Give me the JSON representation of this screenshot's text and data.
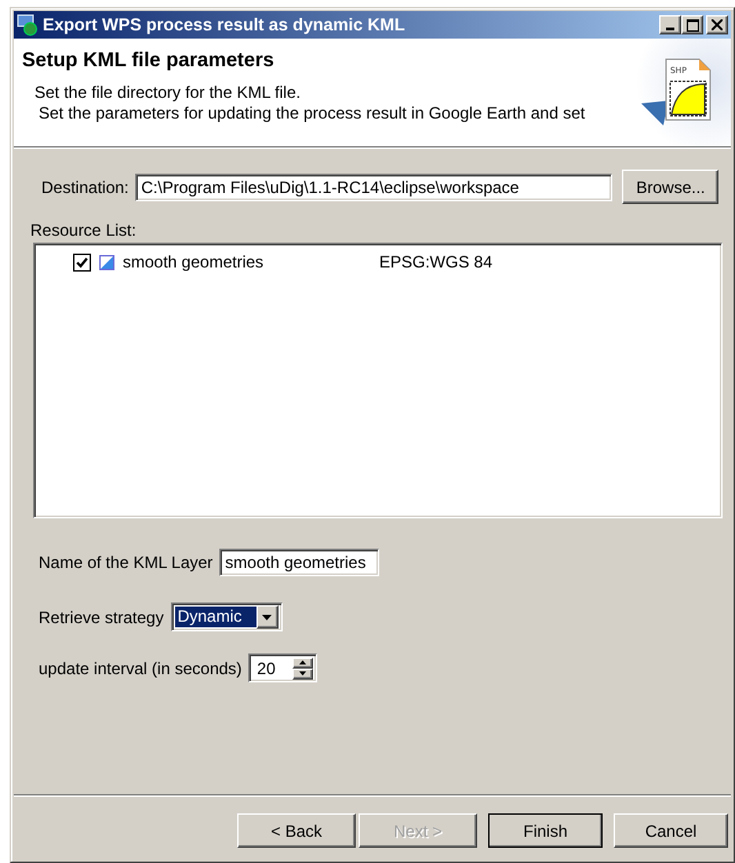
{
  "window": {
    "title": "Export WPS process result as dynamic KML"
  },
  "header": {
    "title": "Setup KML file parameters",
    "icon_text": "SHP",
    "description": [
      "Set the file directory for the KML file.",
      "Set the parameters for updating the process result in Google Earth and set"
    ]
  },
  "destination": {
    "label": "Destination:",
    "value": "C:\\Program Files\\uDig\\1.1-RC14\\eclipse\\workspace",
    "browse": "Browse..."
  },
  "resource_list": {
    "label": "Resource List:",
    "items": [
      {
        "name": "smooth geometries",
        "crs": "EPSG:WGS 84",
        "checked": true
      }
    ]
  },
  "layer_name": {
    "label": "Name of the KML Layer",
    "value": "smooth geometries"
  },
  "retrieve_strategy": {
    "label": "Retrieve strategy",
    "value": "Dynamic",
    "highlighted": true
  },
  "update_interval": {
    "label": "update interval (in seconds)",
    "value": "20"
  },
  "buttons": [
    {
      "label": "< Back",
      "disabled": false,
      "default": false
    },
    {
      "label": "Next >",
      "disabled": true,
      "default": false
    },
    {
      "label": "Finish",
      "disabled": false,
      "default": true
    },
    {
      "label": "Cancel",
      "disabled": false,
      "default": false
    }
  ]
}
